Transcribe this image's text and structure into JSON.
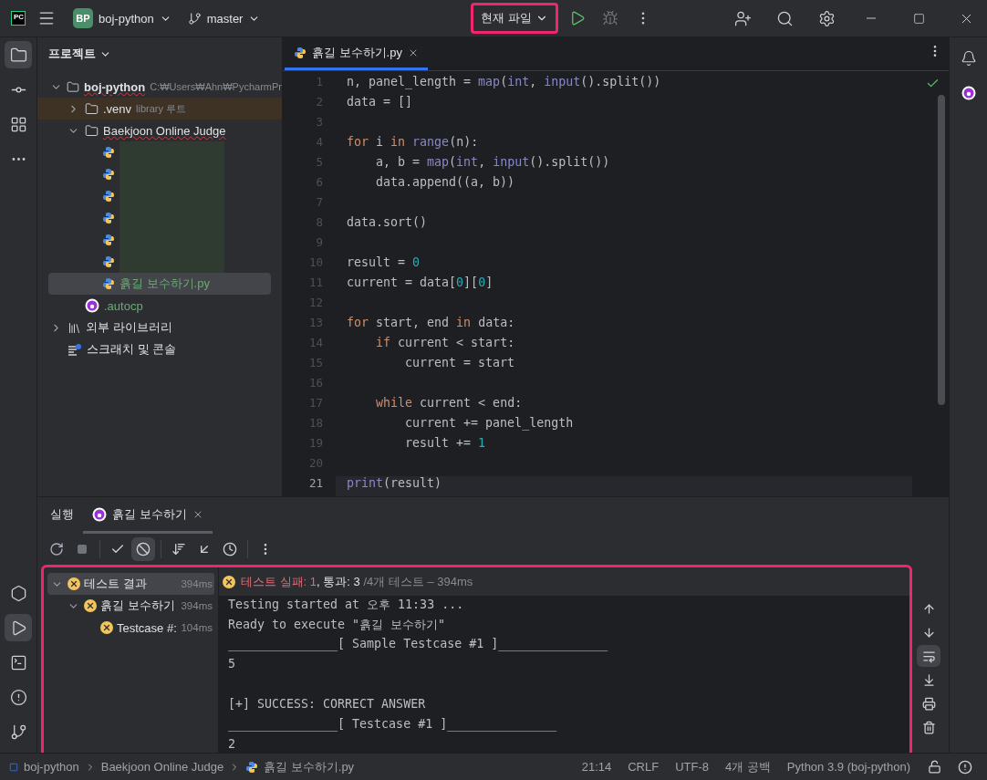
{
  "title_bar": {
    "app_logo": "PC",
    "project": {
      "badge": "BP",
      "name": "boj-python"
    },
    "branch": "master",
    "run_config": {
      "label": "현재 파일",
      "highlighted": true
    }
  },
  "left_toolbar": {
    "top": [
      {
        "selected": true
      },
      {
        "selected": false
      },
      {
        "selected": false
      },
      {
        "selected": false
      }
    ],
    "bottom": [
      {
        "selected": false
      },
      {
        "selected": true
      },
      {
        "selected": false
      },
      {
        "selected": false
      },
      {
        "selected": false
      }
    ]
  },
  "project_panel": {
    "title": "프로젝트",
    "tree": [
      {
        "kind": "folder",
        "label": "boj-python",
        "hint": "C:₩Users₩Ahn₩PycharmPr",
        "expanded": true,
        "typo": true,
        "selected": false,
        "children": [
          {
            "kind": "library",
            "label": ".venv",
            "hint": "library 루트",
            "expanded": false,
            "selected": false
          },
          {
            "kind": "folder",
            "label": "Baekjoon Online Judge",
            "expanded": true,
            "typo": true,
            "selected": false,
            "children": [
              {
                "kind": "redacted",
                "selected": false
              },
              {
                "kind": "redacted",
                "selected": false
              },
              {
                "kind": "redacted",
                "selected": false
              },
              {
                "kind": "redacted",
                "selected": false
              },
              {
                "kind": "redacted",
                "selected": false
              },
              {
                "kind": "redacted",
                "selected": false
              },
              {
                "kind": "python",
                "label": "흙길 보수하기.py",
                "unversioned": true,
                "selected": true
              }
            ]
          },
          {
            "kind": "autocp",
            "label": ".autocp",
            "unversioned": true,
            "selected": false
          }
        ]
      },
      {
        "kind": "external",
        "label": "외부 라이브러리",
        "expanded": false,
        "selected": false
      },
      {
        "kind": "scratch",
        "label": "스크래치 및 콘솔",
        "selected": false
      }
    ]
  },
  "editor": {
    "tabs": [
      {
        "label": "흙길 보수하기.py",
        "selected": true
      }
    ],
    "lines": [
      {
        "number": "1",
        "current": false,
        "tokens": [
          {
            "kind": "plain",
            "text": "n, panel_length = "
          },
          {
            "kind": "builtin",
            "text": "map"
          },
          {
            "kind": "plain",
            "text": "("
          },
          {
            "kind": "builtin",
            "text": "int"
          },
          {
            "kind": "plain",
            "text": ", "
          },
          {
            "kind": "builtin",
            "text": "input"
          },
          {
            "kind": "plain",
            "text": "().split())"
          }
        ]
      },
      {
        "number": "2",
        "current": false,
        "tokens": [
          {
            "kind": "plain",
            "text": "data = []"
          }
        ]
      },
      {
        "number": "3",
        "current": false
      },
      {
        "number": "4",
        "current": false,
        "tokens": [
          {
            "kind": "keyword",
            "text": "for"
          },
          {
            "kind": "plain",
            "text": " i "
          },
          {
            "kind": "keyword",
            "text": "in"
          },
          {
            "kind": "builtin",
            "text": " range"
          },
          {
            "kind": "plain",
            "text": "(n):"
          }
        ]
      },
      {
        "number": "5",
        "current": false,
        "tokens": [
          {
            "kind": "plain",
            "text": "    a, b = "
          },
          {
            "kind": "builtin",
            "text": "map"
          },
          {
            "kind": "plain",
            "text": "("
          },
          {
            "kind": "builtin",
            "text": "int"
          },
          {
            "kind": "plain",
            "text": ", "
          },
          {
            "kind": "builtin",
            "text": "input"
          },
          {
            "kind": "plain",
            "text": "().split())"
          }
        ]
      },
      {
        "number": "6",
        "current": false,
        "tokens": [
          {
            "kind": "plain",
            "text": "    data.append((a, b))"
          }
        ]
      },
      {
        "number": "7",
        "current": false
      },
      {
        "number": "8",
        "current": false,
        "tokens": [
          {
            "kind": "plain",
            "text": "data.sort()"
          }
        ]
      },
      {
        "number": "9",
        "current": false
      },
      {
        "number": "10",
        "current": false,
        "tokens": [
          {
            "kind": "plain",
            "text": "result = "
          },
          {
            "kind": "number",
            "text": "0"
          }
        ]
      },
      {
        "number": "11",
        "current": false,
        "tokens": [
          {
            "kind": "plain",
            "text": "current = data["
          },
          {
            "kind": "number",
            "text": "0"
          },
          {
            "kind": "plain",
            "text": "]["
          },
          {
            "kind": "number",
            "text": "0"
          },
          {
            "kind": "plain",
            "text": "]"
          }
        ]
      },
      {
        "number": "12",
        "current": false
      },
      {
        "number": "13",
        "current": false,
        "tokens": [
          {
            "kind": "keyword",
            "text": "for"
          },
          {
            "kind": "plain",
            "text": " start, end "
          },
          {
            "kind": "keyword",
            "text": "in"
          },
          {
            "kind": "plain",
            "text": " data:"
          }
        ]
      },
      {
        "number": "14",
        "current": false,
        "tokens": [
          {
            "kind": "keyword",
            "text": "    if"
          },
          {
            "kind": "plain",
            "text": " current < start:"
          }
        ]
      },
      {
        "number": "15",
        "current": false,
        "tokens": [
          {
            "kind": "plain",
            "text": "        current = start"
          }
        ]
      },
      {
        "number": "16",
        "current": false
      },
      {
        "number": "17",
        "current": false,
        "tokens": [
          {
            "kind": "keyword",
            "text": "    while"
          },
          {
            "kind": "plain",
            "text": " current < end:"
          }
        ]
      },
      {
        "number": "18",
        "current": false,
        "tokens": [
          {
            "kind": "plain",
            "text": "        current += panel_length"
          }
        ]
      },
      {
        "number": "19",
        "current": false,
        "tokens": [
          {
            "kind": "plain",
            "text": "        result += "
          },
          {
            "kind": "number",
            "text": "1"
          }
        ]
      },
      {
        "number": "20",
        "current": false
      },
      {
        "number": "21",
        "current": true,
        "tokens": [
          {
            "kind": "builtin",
            "text": "print"
          },
          {
            "kind": "plain",
            "text": "(result)"
          }
        ]
      }
    ]
  },
  "run_panel": {
    "tabs": [
      {
        "label": "실행",
        "kind": "title",
        "selected": false
      },
      {
        "label": "흙길 보수하기",
        "kind": "config",
        "selected": true
      }
    ],
    "highlighted": true,
    "test_tree": [
      {
        "label": "테스트 결과",
        "time": "394ms",
        "failed": true,
        "expanded": true,
        "selected": true,
        "children": [
          {
            "label": "흙길 보수하기",
            "time": "394ms",
            "failed": true,
            "expanded": true,
            "selected": false,
            "children": [
              {
                "label": "Testcase #:",
                "time": "104ms",
                "failed": true,
                "selected": false
              }
            ]
          }
        ]
      }
    ],
    "summary": {
      "failed": true,
      "segments": [
        {
          "text": "테스트 실패: 1",
          "kind": "failed"
        },
        {
          "text": ", 통과: 3",
          "kind": "passed"
        },
        {
          "text": " /4개 테스트 – 394ms",
          "kind": "total"
        }
      ]
    },
    "console": [
      [
        "Testing started at 오후 11:33 ...",
        "Ready to execute \"흙길 보수하기\"",
        "_______________[ Sample Testcase #1 ]_______________",
        "5"
      ],
      [
        "[+] SUCCESS: CORRECT ANSWER",
        "_______________[ Testcase #1 ]_______________",
        "2"
      ]
    ]
  },
  "status_bar": {
    "breadcrumbs": [
      {
        "label": "boj-python",
        "kind": "module"
      },
      {
        "label": "Baekjoon Online Judge",
        "kind": "folder"
      },
      {
        "label": "흙길 보수하기.py",
        "kind": "python"
      }
    ],
    "items": [
      "21:14",
      "CRLF",
      "UTF-8",
      "4개 공백",
      "Python 3.9 (boj-python)"
    ]
  }
}
